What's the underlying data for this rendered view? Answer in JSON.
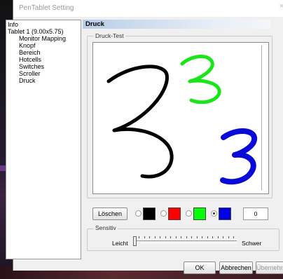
{
  "window": {
    "title": "PenTablet Setting",
    "close_glyph": "×"
  },
  "sidebar": {
    "items": [
      {
        "label": "Info",
        "level": "top"
      },
      {
        "label": "Tablet  1 (9.00x5.75)",
        "level": "top"
      },
      {
        "label": "Monitor Mapping",
        "level": "sub"
      },
      {
        "label": "Knopf",
        "level": "sub"
      },
      {
        "label": "Bereich",
        "level": "sub"
      },
      {
        "label": "Hotcells",
        "level": "sub"
      },
      {
        "label": "Switches",
        "level": "sub"
      },
      {
        "label": "Scroller",
        "level": "sub"
      },
      {
        "label": "Druck",
        "level": "sub"
      }
    ]
  },
  "page": {
    "title": "Druck"
  },
  "test_group": {
    "legend": "Druck-Test"
  },
  "controls": {
    "clear_label": "Löschen",
    "colors": [
      {
        "name": "black",
        "hex": "#000000",
        "selected": false
      },
      {
        "name": "red",
        "hex": "#ff0000",
        "selected": false
      },
      {
        "name": "green",
        "hex": "#00ff00",
        "selected": false
      },
      {
        "name": "blue",
        "hex": "#0000e6",
        "selected": true
      }
    ],
    "pressure_value": "0"
  },
  "sensitivity": {
    "legend": "Sensitiv",
    "min_label": "Leicht",
    "max_label": "Schwer",
    "level": 0
  },
  "footer": {
    "ok_label": "OK",
    "cancel_label": "Abbrechen",
    "apply_label": "Übernehmen"
  }
}
